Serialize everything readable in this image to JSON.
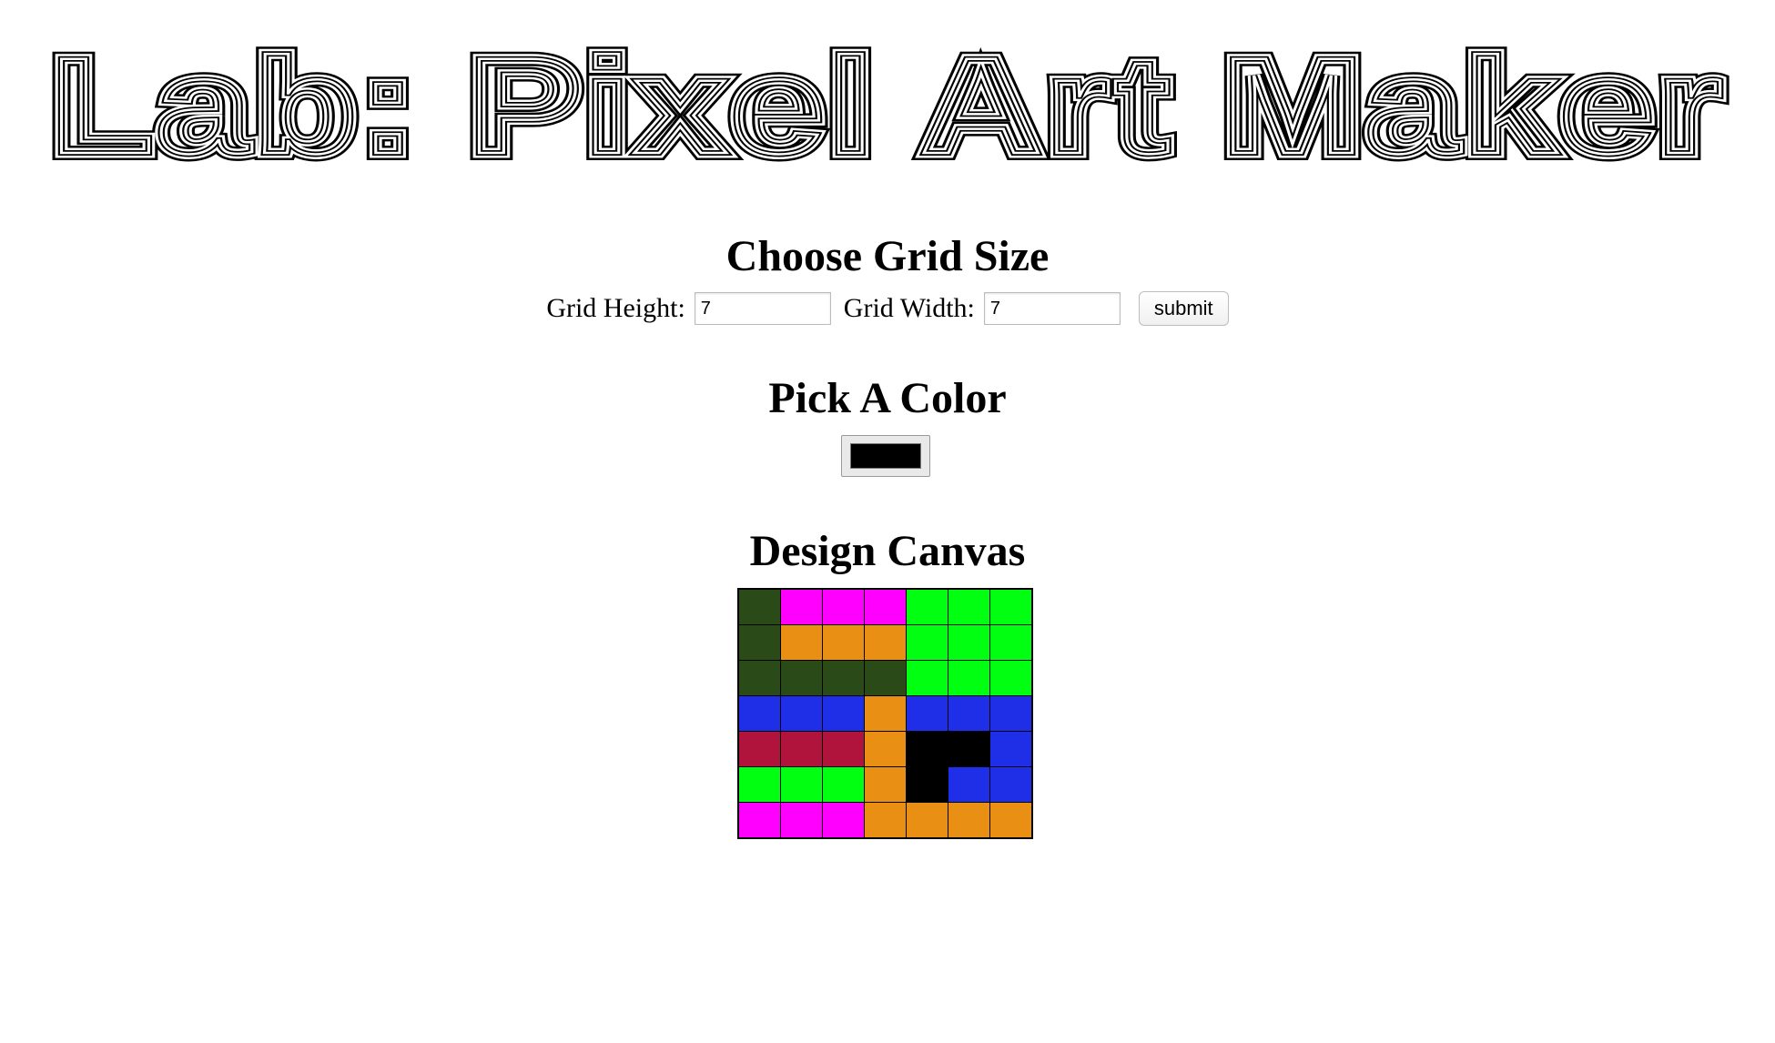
{
  "page": {
    "title": "Lab: Pixel Art Maker"
  },
  "grid_size": {
    "heading": "Choose Grid Size",
    "height_label": "Grid Height:",
    "height_value": "7",
    "width_label": "Grid Width:",
    "width_value": "7",
    "submit_label": "submit"
  },
  "color": {
    "heading": "Pick A Color",
    "selected": "#000000"
  },
  "canvas": {
    "heading": "Design Canvas",
    "palette": {
      "D": "#2a4a18",
      "M": "#ff00ff",
      "G": "#00ff10",
      "O": "#e98f14",
      "B": "#1f2fe8",
      "R": "#b0143c",
      "K": "#000000"
    },
    "rows": [
      [
        "D",
        "M",
        "M",
        "M",
        "G",
        "G",
        "G"
      ],
      [
        "D",
        "O",
        "O",
        "O",
        "G",
        "G",
        "G"
      ],
      [
        "D",
        "D",
        "D",
        "D",
        "G",
        "G",
        "G"
      ],
      [
        "B",
        "B",
        "B",
        "O",
        "B",
        "B",
        "B"
      ],
      [
        "R",
        "R",
        "R",
        "O",
        "K",
        "K",
        "B"
      ],
      [
        "G",
        "G",
        "G",
        "O",
        "K",
        "B",
        "B"
      ],
      [
        "M",
        "M",
        "M",
        "O",
        "O",
        "O",
        "O"
      ]
    ]
  }
}
